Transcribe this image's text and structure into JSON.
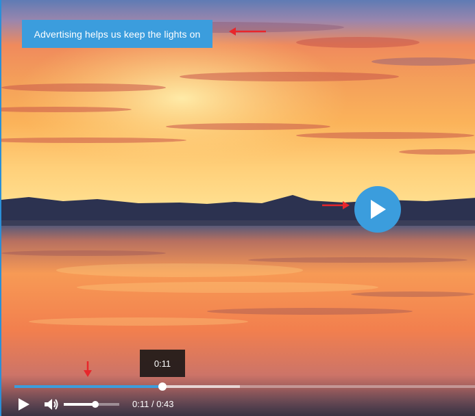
{
  "ad_banner": {
    "text": "Advertising helps us keep the lights on"
  },
  "tooltip": {
    "time": "0:11"
  },
  "player": {
    "current_time": "0:11",
    "separator": " / ",
    "duration": "0:43",
    "progress_fraction": 0.321,
    "buffered_fraction": 0.488,
    "volume_fraction": 0.57
  },
  "colors": {
    "accent": "#3b9ddd",
    "annotation_arrow": "#e8262b"
  },
  "icons": {
    "big_play": "play-icon",
    "play": "play-icon",
    "volume": "volume-icon"
  }
}
